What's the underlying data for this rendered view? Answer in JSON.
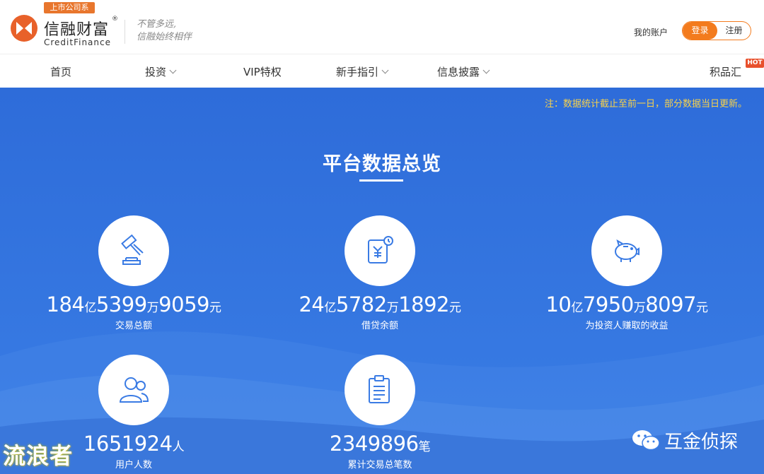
{
  "header": {
    "badge": "上市公司系",
    "brand_cn": "信融财富",
    "brand_reg": "®",
    "brand_en": "CreditFinance",
    "slogan_1": "不管多远,",
    "slogan_2": "信融始终相伴",
    "account": "我的账户",
    "login": "登录",
    "register": "注册"
  },
  "nav": {
    "home": "首页",
    "invest": "投资",
    "vip": "VIP特权",
    "guide": "新手指引",
    "disclosure": "信息披露",
    "points": "积品汇",
    "hot": "HOT"
  },
  "main": {
    "notice": "注：数据统计截止至前一日，部分数据当日更新。",
    "title": "平台数据总览"
  },
  "stats": [
    {
      "icon": "gavel-icon",
      "parts": [
        "184",
        "亿",
        "5399",
        "万",
        "9059",
        "元"
      ],
      "label": "交易总额"
    },
    {
      "icon": "yuan-doc-clock-icon",
      "parts": [
        "24",
        "亿",
        "5782",
        "万",
        "1892",
        "元"
      ],
      "label": "借贷余额"
    },
    {
      "icon": "piggy-bank-icon",
      "parts": [
        "10",
        "亿",
        "7950",
        "万",
        "8097",
        "元"
      ],
      "label": "为投资人赚取的收益"
    },
    {
      "icon": "users-icon",
      "parts": [
        "1651924",
        "人"
      ],
      "label": "用户人数"
    },
    {
      "icon": "clipboard-icon",
      "parts": [
        "2349896",
        "笔"
      ],
      "label": "累计交易总笔数"
    }
  ],
  "watermarks": {
    "left": "流浪者",
    "right": "互金侦探"
  },
  "colors": {
    "brand_orange": "#f37b1d",
    "panel_blue": "#2f70dc",
    "notice_yellow": "#f8d24a"
  }
}
